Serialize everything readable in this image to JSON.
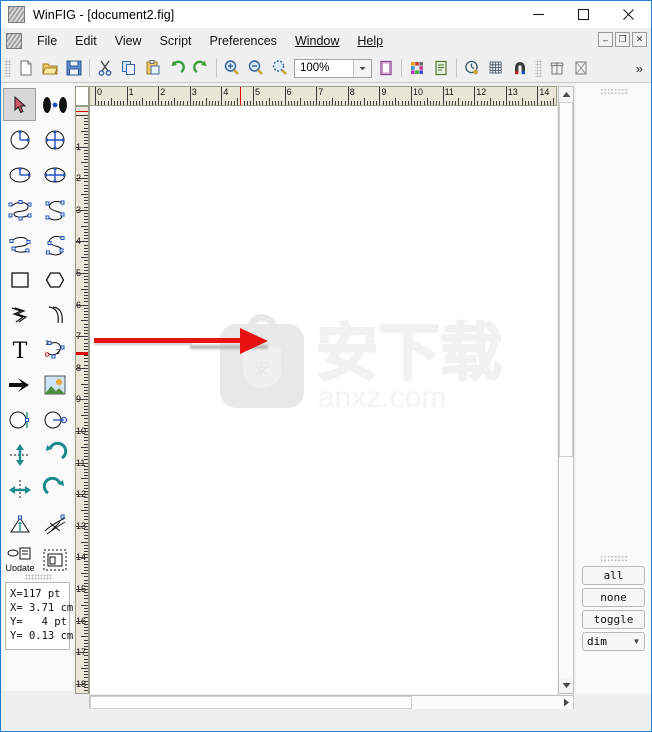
{
  "window": {
    "title": "WinFIG - [document2.fig]",
    "app_icon": "winfig-logo-icon",
    "controls": {
      "minimize": "minimize-icon",
      "maximize": "maximize-icon",
      "close": "close-icon"
    }
  },
  "menubar": {
    "icon": "mdi-document-icon",
    "items": [
      {
        "label": "File",
        "accel": ""
      },
      {
        "label": "Edit",
        "accel": ""
      },
      {
        "label": "View",
        "accel": ""
      },
      {
        "label": "Script",
        "accel": ""
      },
      {
        "label": "Preferences",
        "accel": ""
      },
      {
        "label": "Window",
        "accel": "W"
      },
      {
        "label": "Help",
        "accel": "H"
      }
    ],
    "mdi_controls": [
      {
        "name": "mdi-minimize-button",
        "glyph": "–"
      },
      {
        "name": "mdi-restore-button",
        "glyph": "❐"
      },
      {
        "name": "mdi-close-button",
        "glyph": "✕"
      }
    ]
  },
  "toolbar": {
    "zoom_value": "100%",
    "overflow_label": "»",
    "buttons": [
      {
        "name": "new-file-button",
        "icon": "new-document-icon",
        "title": "New"
      },
      {
        "name": "open-file-button",
        "icon": "open-folder-icon",
        "title": "Open"
      },
      {
        "name": "save-file-button",
        "icon": "floppy-save-icon",
        "title": "Save"
      },
      {
        "name": "cut-button",
        "icon": "scissors-icon",
        "title": "Cut"
      },
      {
        "name": "copy-button",
        "icon": "copy-pages-icon",
        "title": "Copy"
      },
      {
        "name": "paste-button",
        "icon": "clipboard-paste-icon",
        "title": "Paste"
      },
      {
        "name": "undo-button",
        "icon": "undo-arrow-icon",
        "title": "Undo"
      },
      {
        "name": "redo-button",
        "icon": "redo-arrow-icon",
        "title": "Redo"
      },
      {
        "name": "zoom-in-button",
        "icon": "magnifier-plus-icon",
        "title": "Zoom In"
      },
      {
        "name": "zoom-out-button",
        "icon": "magnifier-minus-icon",
        "title": "Zoom Out"
      },
      {
        "name": "zoom-fit-button",
        "icon": "magnifier-fit-icon",
        "title": "Zoom Fit"
      },
      {
        "name": "page-setup-button",
        "icon": "page-frame-icon",
        "title": "Page"
      },
      {
        "name": "color-palette-button",
        "icon": "color-palette-icon",
        "title": "Colors"
      },
      {
        "name": "properties-button",
        "icon": "properties-sheet-icon",
        "title": "Properties"
      },
      {
        "name": "history-button",
        "icon": "clock-history-icon",
        "title": "History"
      },
      {
        "name": "grid-button",
        "icon": "grid-icon",
        "title": "Grid"
      },
      {
        "name": "snap-magnet-button",
        "icon": "magnet-icon",
        "title": "Snap"
      },
      {
        "name": "library-button",
        "icon": "gift-box-icon",
        "title": "Library"
      },
      {
        "name": "export-button",
        "icon": "export-sheet-icon",
        "title": "Export"
      }
    ]
  },
  "tool_palette": {
    "selected": "select-tool",
    "tools": [
      {
        "name": "select-tool",
        "icon": "arrow-cursor-icon",
        "selected": true
      },
      {
        "name": "align-points-tool",
        "icon": "two-points-icon",
        "selected": false
      },
      {
        "name": "circle-radius-tool",
        "icon": "circle-radius-icon",
        "selected": false
      },
      {
        "name": "circle-diameter-tool",
        "icon": "circle-diameter-icon",
        "selected": false
      },
      {
        "name": "ellipse-radius-tool",
        "icon": "ellipse-radius-icon",
        "selected": false
      },
      {
        "name": "ellipse-diameter-tool",
        "icon": "ellipse-diameter-icon",
        "selected": false
      },
      {
        "name": "closed-spline-tool",
        "icon": "closed-spline-icon",
        "selected": false
      },
      {
        "name": "open-spline-tool",
        "icon": "open-spline-icon",
        "selected": false
      },
      {
        "name": "closed-bezier-tool",
        "icon": "closed-bezier-icon",
        "selected": false
      },
      {
        "name": "open-bezier-tool",
        "icon": "open-bezier-icon",
        "selected": false
      },
      {
        "name": "rectangle-tool",
        "icon": "rectangle-icon",
        "selected": false
      },
      {
        "name": "polygon-tool",
        "icon": "hexagon-icon",
        "selected": false
      },
      {
        "name": "polyline-tool",
        "icon": "polyline-arrow-icon",
        "selected": false
      },
      {
        "name": "arc-tool",
        "icon": "arc-icon",
        "selected": false
      },
      {
        "name": "text-tool",
        "icon": "text-t-icon",
        "selected": false
      },
      {
        "name": "curve-points-tool",
        "icon": "numbered-curve-icon",
        "selected": false
      },
      {
        "name": "arrow-tool",
        "icon": "solid-arrow-icon",
        "selected": false
      },
      {
        "name": "picture-tool",
        "icon": "picture-image-icon",
        "selected": false
      },
      {
        "name": "circle-edge-tool",
        "icon": "circle-edge-point-icon",
        "selected": false
      },
      {
        "name": "circle-center-tool",
        "icon": "circle-center-point-icon",
        "selected": false
      },
      {
        "name": "flip-vertical-tool",
        "icon": "flip-vertical-icon",
        "selected": false
      },
      {
        "name": "rotate-ccw-tool",
        "icon": "rotate-ccw-icon",
        "selected": false
      },
      {
        "name": "flip-horizontal-tool",
        "icon": "flip-horizontal-icon",
        "selected": false
      },
      {
        "name": "rotate-cw-tool",
        "icon": "rotate-cw-icon",
        "selected": false
      },
      {
        "name": "scale-tool",
        "icon": "scale-triangle-icon",
        "selected": false
      },
      {
        "name": "shear-tool",
        "icon": "shear-icon",
        "selected": false
      },
      {
        "name": "update-tool",
        "icon": "update-icon",
        "selected": false,
        "label": "Update"
      },
      {
        "name": "edit-object-tool",
        "icon": "edit-object-icon",
        "selected": false
      },
      {
        "name": "delete-tool",
        "icon": "delete-x-icon",
        "selected": false
      }
    ]
  },
  "coords": {
    "lines": [
      "X=117 pt",
      "X= 3.71 cm",
      "Y=   4 pt",
      "Y= 0.13 cm"
    ],
    "text": "X=117 pt\nX= 3.71 cm\nY=   4 pt\nY= 0.13 cm"
  },
  "rulers": {
    "horizontal": {
      "unit": "cm",
      "labels": [
        "0",
        "1",
        "2",
        "3",
        "4",
        "5",
        "6",
        "7",
        "8",
        "9",
        "10",
        "11",
        "12",
        "13",
        "14"
      ],
      "marker_at": 4.6
    },
    "vertical": {
      "unit": "cm",
      "labels": [
        "1",
        "2",
        "3",
        "4",
        "5",
        "6",
        "7",
        "8",
        "9",
        "10",
        "11",
        "12",
        "13",
        "14",
        "15",
        "16",
        "17",
        "18"
      ],
      "marker_at": 7.5
    }
  },
  "canvas": {
    "watermark": {
      "cn_text": "安下载",
      "en_text": "anxz.com",
      "badge_char": "安"
    },
    "annotation": {
      "name": "red-arrow-annotation",
      "color": "#e81111",
      "direction": "right"
    }
  },
  "right_panel": {
    "buttons": [
      {
        "name": "select-all-button",
        "label": "all"
      },
      {
        "name": "select-none-button",
        "label": "none"
      },
      {
        "name": "select-toggle-button",
        "label": "toggle"
      }
    ],
    "dropdown": {
      "name": "depth-mode-dropdown",
      "value": "dim",
      "caret": "▼"
    }
  },
  "scrollbars": {
    "vertical": {
      "up": "▲",
      "down": "▼"
    },
    "horizontal": {
      "right": "▶"
    }
  },
  "colors": {
    "window_border": "#1e7fd4",
    "ruler_bg": "#eae6d7",
    "panel_bg": "#fafafa",
    "annotation_red": "#e81111",
    "canvas_bg": "#ffffff"
  }
}
